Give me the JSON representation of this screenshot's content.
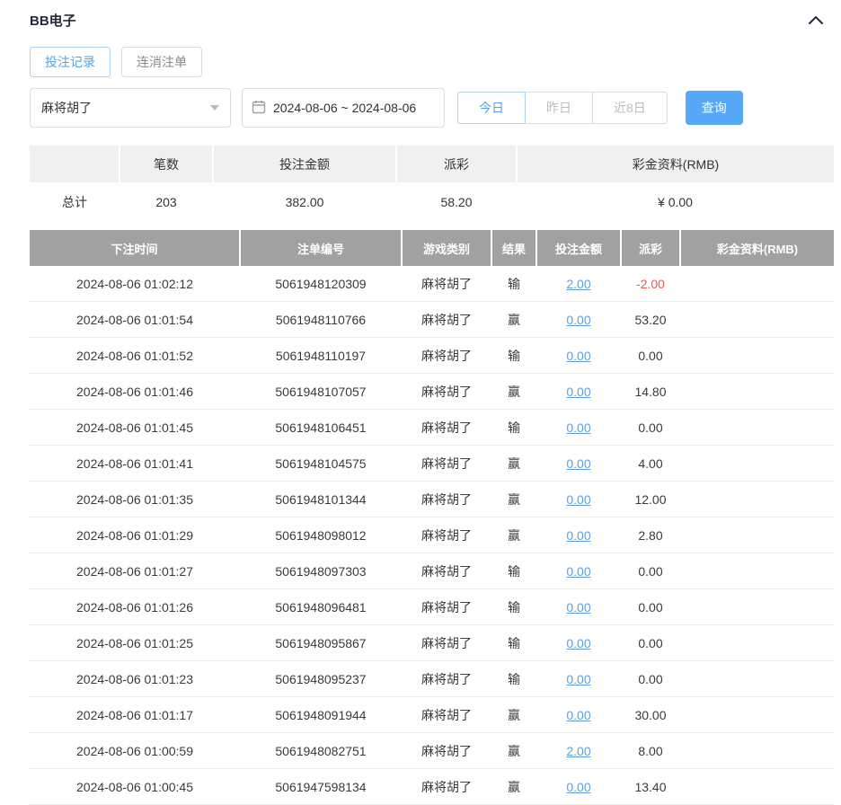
{
  "panel": {
    "title": "BB电子",
    "collapse_icon": "chevron-up-icon"
  },
  "tabs": [
    {
      "label": "投注记录",
      "active": true
    },
    {
      "label": "连消注单",
      "active": false
    }
  ],
  "filters": {
    "game_select": {
      "value": "麻将胡了"
    },
    "date_range": {
      "value": "2024-08-06 ~ 2024-08-06"
    },
    "quick_buttons": [
      {
        "label": "今日",
        "active": true
      },
      {
        "label": "昨日",
        "active": false
      },
      {
        "label": "近8日",
        "active": false
      }
    ],
    "search_label": "查询"
  },
  "colors": {
    "accent_blue": "#58a8f8",
    "link_blue": "#5e9fe5",
    "negative_red": "#e05a5a",
    "table_header_gray": "#a1a1a1"
  },
  "summary": {
    "headers": [
      "",
      "笔数",
      "投注金额",
      "派彩",
      "彩金资料(RMB)"
    ],
    "row_label": "总计",
    "count": "203",
    "bet_amount": "382.00",
    "payout": "58.20",
    "jackpot": "¥ 0.00"
  },
  "table": {
    "headers": [
      "下注时间",
      "注单编号",
      "游戏类别",
      "结果",
      "投注金额",
      "派彩",
      "彩金资料(RMB)"
    ],
    "rows": [
      {
        "time": "2024-08-06 01:02:12",
        "order": "5061948120309",
        "game": "麻将胡了",
        "result": "输",
        "bet": "2.00",
        "payout": "-2.00",
        "jackpot": ""
      },
      {
        "time": "2024-08-06 01:01:54",
        "order": "5061948110766",
        "game": "麻将胡了",
        "result": "赢",
        "bet": "0.00",
        "payout": "53.20",
        "jackpot": ""
      },
      {
        "time": "2024-08-06 01:01:52",
        "order": "5061948110197",
        "game": "麻将胡了",
        "result": "输",
        "bet": "0.00",
        "payout": "0.00",
        "jackpot": ""
      },
      {
        "time": "2024-08-06 01:01:46",
        "order": "5061948107057",
        "game": "麻将胡了",
        "result": "赢",
        "bet": "0.00",
        "payout": "14.80",
        "jackpot": ""
      },
      {
        "time": "2024-08-06 01:01:45",
        "order": "5061948106451",
        "game": "麻将胡了",
        "result": "输",
        "bet": "0.00",
        "payout": "0.00",
        "jackpot": ""
      },
      {
        "time": "2024-08-06 01:01:41",
        "order": "5061948104575",
        "game": "麻将胡了",
        "result": "赢",
        "bet": "0.00",
        "payout": "4.00",
        "jackpot": ""
      },
      {
        "time": "2024-08-06 01:01:35",
        "order": "5061948101344",
        "game": "麻将胡了",
        "result": "赢",
        "bet": "0.00",
        "payout": "12.00",
        "jackpot": ""
      },
      {
        "time": "2024-08-06 01:01:29",
        "order": "5061948098012",
        "game": "麻将胡了",
        "result": "赢",
        "bet": "0.00",
        "payout": "2.80",
        "jackpot": ""
      },
      {
        "time": "2024-08-06 01:01:27",
        "order": "5061948097303",
        "game": "麻将胡了",
        "result": "输",
        "bet": "0.00",
        "payout": "0.00",
        "jackpot": ""
      },
      {
        "time": "2024-08-06 01:01:26",
        "order": "5061948096481",
        "game": "麻将胡了",
        "result": "输",
        "bet": "0.00",
        "payout": "0.00",
        "jackpot": ""
      },
      {
        "time": "2024-08-06 01:01:25",
        "order": "5061948095867",
        "game": "麻将胡了",
        "result": "输",
        "bet": "0.00",
        "payout": "0.00",
        "jackpot": ""
      },
      {
        "time": "2024-08-06 01:01:23",
        "order": "5061948095237",
        "game": "麻将胡了",
        "result": "输",
        "bet": "0.00",
        "payout": "0.00",
        "jackpot": ""
      },
      {
        "time": "2024-08-06 01:01:17",
        "order": "5061948091944",
        "game": "麻将胡了",
        "result": "赢",
        "bet": "0.00",
        "payout": "30.00",
        "jackpot": ""
      },
      {
        "time": "2024-08-06 01:00:59",
        "order": "5061948082751",
        "game": "麻将胡了",
        "result": "赢",
        "bet": "2.00",
        "payout": "8.00",
        "jackpot": ""
      },
      {
        "time": "2024-08-06 01:00:45",
        "order": "5061947598134",
        "game": "麻将胡了",
        "result": "赢",
        "bet": "0.00",
        "payout": "13.40",
        "jackpot": ""
      }
    ]
  }
}
